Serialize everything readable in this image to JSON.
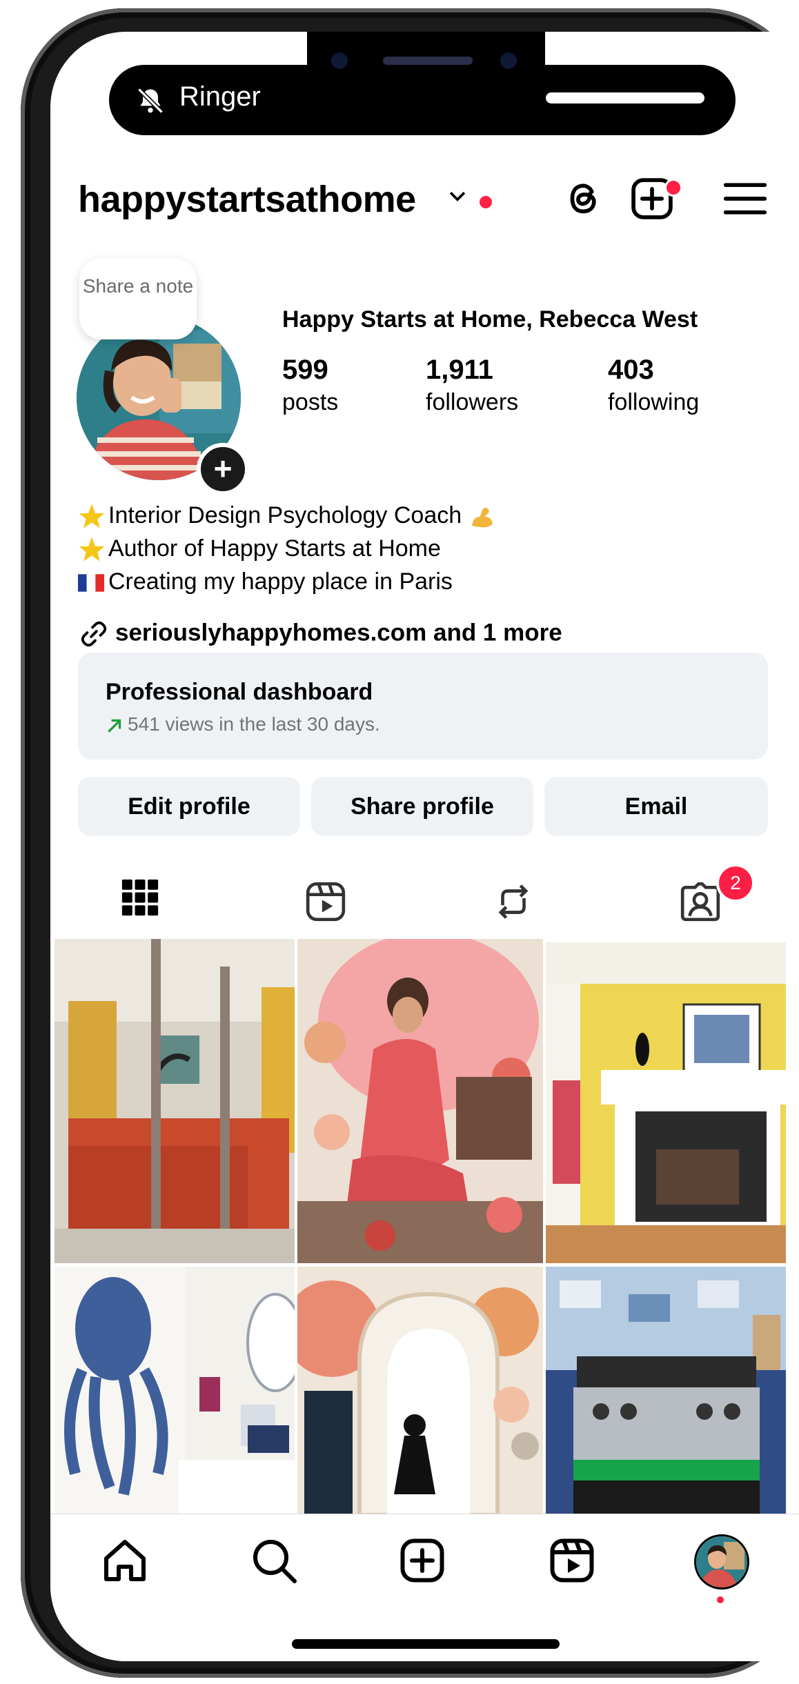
{
  "status": {
    "ringer_label": "Ringer"
  },
  "header": {
    "username": "happystartsathome",
    "accent": "#ff1f45"
  },
  "note": {
    "label": "Share a note"
  },
  "profile": {
    "full_name": "Happy Starts at Home, Rebecca West",
    "stats": [
      {
        "value": "599",
        "label": "posts"
      },
      {
        "value": "1,911",
        "label": "followers"
      },
      {
        "value": "403",
        "label": "following"
      }
    ],
    "bio": [
      {
        "icon": "star-glow-icon",
        "text": "Interior Design Psychology Coach",
        "trail_icon": "flexed-biceps-icon"
      },
      {
        "icon": "star-glow-icon",
        "text": "Author of Happy Starts at Home"
      },
      {
        "icon": "france-flag-icon",
        "text": "Creating my happy place in Paris"
      }
    ],
    "link": "seriouslyhappyhomes.com and 1 more"
  },
  "dashboard": {
    "title": "Professional dashboard",
    "subtitle": "541 views in the last 30 days.",
    "trend_color": "#1f9d3a"
  },
  "buttons": {
    "edit": "Edit profile",
    "share": "Share profile",
    "email": "Email"
  },
  "tabs": {
    "items": [
      "grid-icon",
      "reels-icon",
      "reposts-icon",
      "tagged-icon"
    ],
    "tagged_badge": "2"
  },
  "grid": {
    "posts": [
      "bedroom-post",
      "collage-woman-post",
      "fireplace-post",
      "octopus-bathroom-post",
      "arch-collage-post",
      "kitchen-stove-post"
    ]
  },
  "nav": {
    "items": [
      "home-icon",
      "search-icon",
      "create-icon",
      "reels-icon",
      "profile-avatar"
    ]
  }
}
